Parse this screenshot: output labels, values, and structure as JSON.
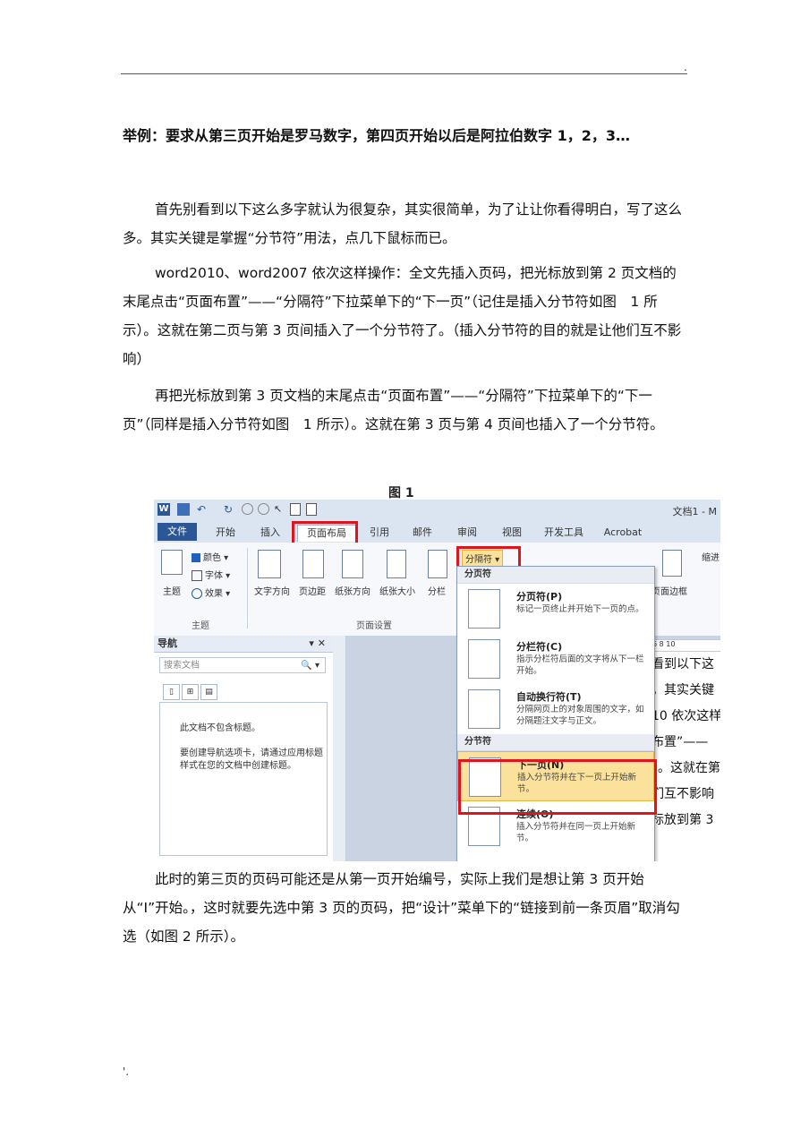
{
  "header": {
    "dot": "."
  },
  "footer": {
    "dot": "'."
  },
  "title": "举例：要求从第三页开始是罗马数字，第四页开始以后是阿拉伯数字 1，2，3…",
  "paragraphs": {
    "p1": "首先别看到以下这么多字就认为很复杂，其实很简单，为了让让你看得明白，写了这么多。其实关键是掌握“分节符”用法，点几下鼠标而已。",
    "p2": "word2010、word2007 依次这样操作：全文先插入页码，把光标放到第 2 页文档的末尾点击“页面布置”——“分隔符”下拉菜单下的“下一页”（记住是插入分节符如图　1 所示）。这就在第二页与第 3 页间插入了一个分节符了。（插入分节符的目的就是让他们互不影响）",
    "p3": "再把光标放到第 3 页文档的末尾点击“页面布置”——“分隔符”下拉菜单下的“下一页”（同样是插入分节符如图　1 所示）。这就在第 3 页与第 4 页间也插入了一个分节符。",
    "p4": "此时的第三页的页码可能还是从第一页开始编号，实际上我们是想让第 3 页开始从“I”开始。，这时就要先选中第 3 页的页码，把“设计”菜单下的“链接到前一条页眉”取消勾选（如图 2 所示）。"
  },
  "figure_caption": "图 1",
  "screenshot": {
    "window_title": "文档1 - M",
    "tabs": [
      "文件",
      "开始",
      "插入",
      "页面布局",
      "引用",
      "邮件",
      "审阅",
      "视图",
      "开发工具",
      "Acrobat"
    ],
    "ribbon": {
      "theme_items": [
        "颜色 ▾",
        "字体 ▾",
        "效果 ▾"
      ],
      "theme_button": "主题",
      "page_setup_buttons": [
        "文字方向",
        "页边距",
        "纸张方向",
        "纸张大小",
        "分栏"
      ],
      "breaks_button": "分隔符 ▾",
      "page_border": "页面边框",
      "indent_label": "缩进",
      "group_theme": "主题",
      "group_page_setup": "页面设置"
    },
    "nav_pane": {
      "title": "导航",
      "controls": "▾ ✕",
      "search_placeholder": "搜索文档",
      "search_icon": "🔍 ▾",
      "no_headings": "此文档不包含标题。",
      "hint": "要创建导航选项卡，请通过应用标题样式在您的文档中创建标题。"
    },
    "breaks_menu": {
      "section_page": "分页符",
      "section_section": "分节符",
      "items": [
        {
          "title": "分页符(P)",
          "desc": "标记一页终止并开始下一页的点。"
        },
        {
          "title": "分栏符(C)",
          "desc": "指示分栏符后面的文字将从下一栏开始。"
        },
        {
          "title": "自动换行符(T)",
          "desc": "分隔网页上的对象周围的文字，如分隔题注文字与正文。"
        },
        {
          "title": "下一页(N)",
          "desc": "插入分节符并在下一页上开始新节。"
        },
        {
          "title": "连续(O)",
          "desc": "插入分节符并在同一页上开始新节。"
        }
      ]
    },
    "doc_lines": [
      "看到以下这",
      "。其实关键",
      "10 依次这样",
      "布置”——",
      "）。这就在第",
      "们互不影响",
      "标放到第 3"
    ],
    "ruler_marks": "6   8   10"
  }
}
